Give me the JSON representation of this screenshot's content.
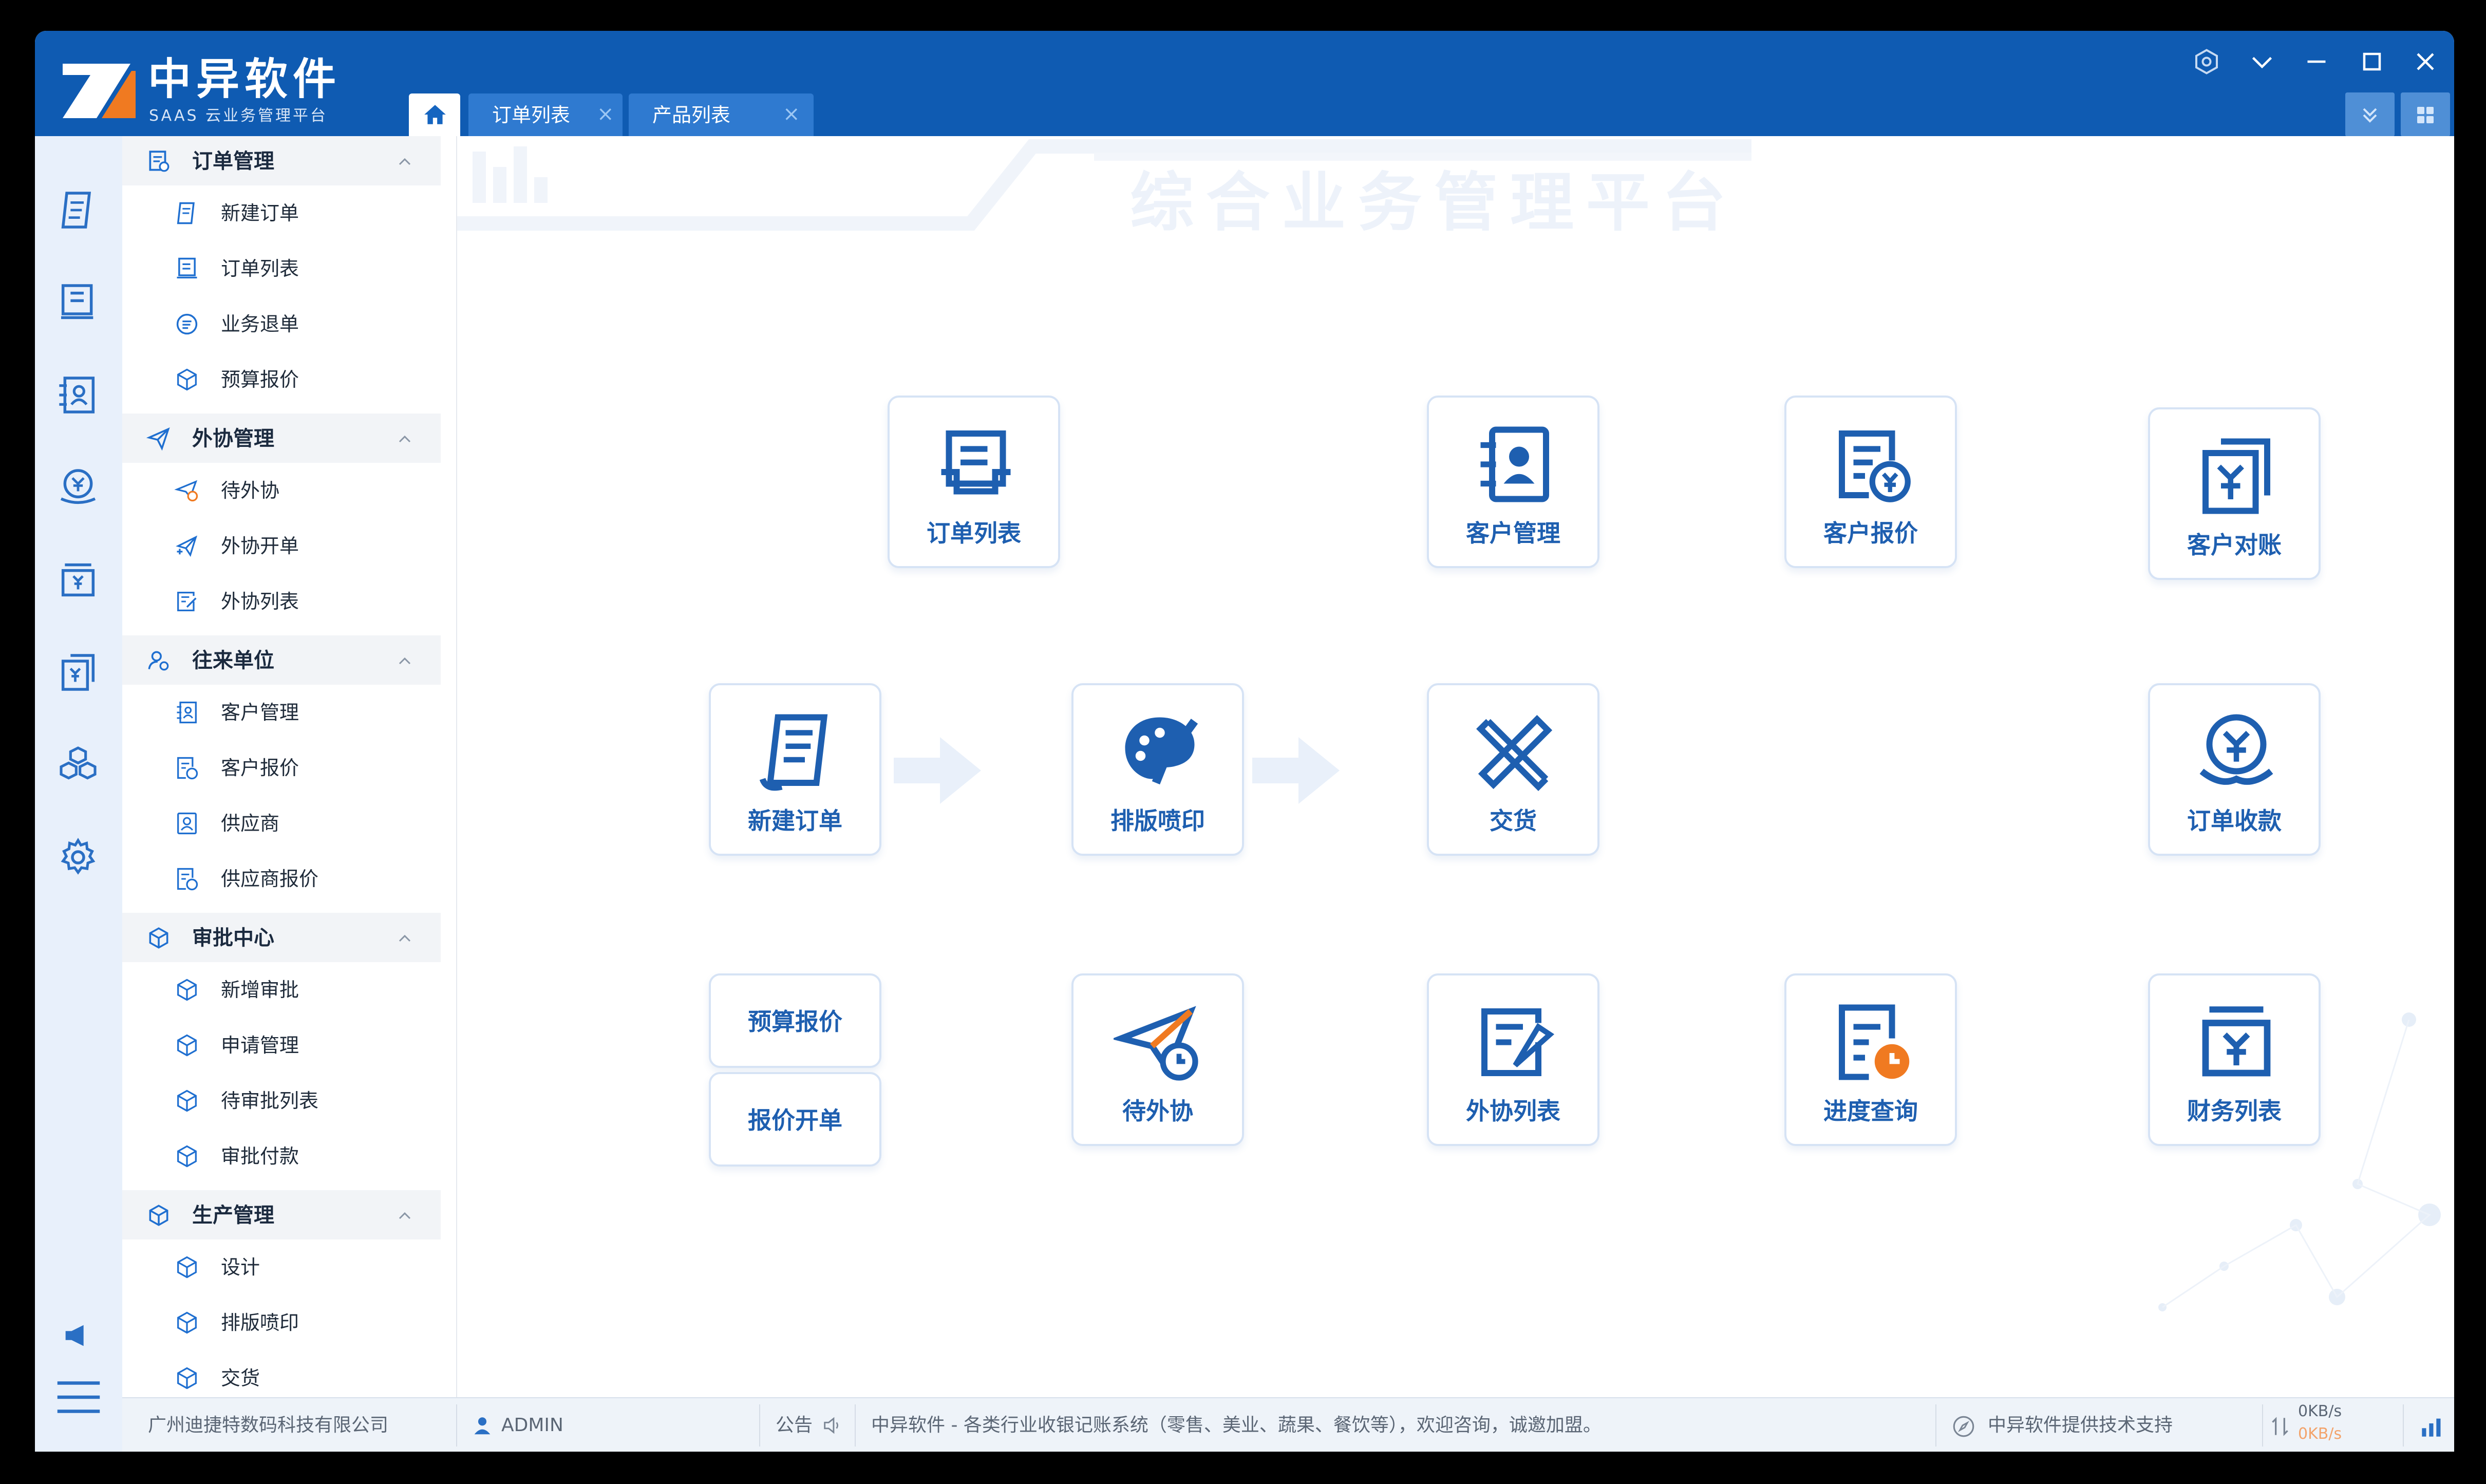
{
  "brand": {
    "name": "中异软件",
    "subtitle": "SAAS 云业务管理平台"
  },
  "tabs": [
    {
      "label": "订单列表",
      "closable": true
    },
    {
      "label": "产品列表",
      "closable": true
    }
  ],
  "watermark": "综合业务管理平台",
  "sidebar": {
    "groups": [
      {
        "label": "订单管理",
        "icon": "order-icon",
        "items": [
          {
            "label": "新建订单",
            "icon": "new-order-icon"
          },
          {
            "label": "订单列表",
            "icon": "order-list-icon"
          },
          {
            "label": "业务退单",
            "icon": "refund-icon"
          },
          {
            "label": "预算报价",
            "icon": "box-icon"
          }
        ]
      },
      {
        "label": "外协管理",
        "icon": "paper-plane-icon",
        "items": [
          {
            "label": "待外协",
            "icon": "paper-plane-clock-icon"
          },
          {
            "label": "外协开单",
            "icon": "paper-plane-plus-icon"
          },
          {
            "label": "外协列表",
            "icon": "list-edit-icon"
          }
        ]
      },
      {
        "label": "往来单位",
        "icon": "user-gear-icon",
        "items": [
          {
            "label": "客户管理",
            "icon": "contact-card-icon"
          },
          {
            "label": "客户报价",
            "icon": "quote-icon"
          },
          {
            "label": "供应商",
            "icon": "supplier-icon"
          },
          {
            "label": "供应商报价",
            "icon": "quote-icon"
          }
        ]
      },
      {
        "label": "审批中心",
        "icon": "box-icon",
        "items": [
          {
            "label": "新增审批",
            "icon": "box-icon"
          },
          {
            "label": "申请管理",
            "icon": "box-icon"
          },
          {
            "label": "待审批列表",
            "icon": "box-icon"
          },
          {
            "label": "审批付款",
            "icon": "box-icon"
          }
        ]
      },
      {
        "label": "生产管理",
        "icon": "box-icon",
        "items": [
          {
            "label": "设计",
            "icon": "box-icon"
          },
          {
            "label": "排版喷印",
            "icon": "box-icon"
          },
          {
            "label": "交货",
            "icon": "box-icon"
          }
        ]
      }
    ]
  },
  "cards": {
    "order_list": "订单列表",
    "customer_mgmt": "客户管理",
    "customer_quote": "客户报价",
    "customer_reconcile": "客户对账",
    "new_order": "新建订单",
    "layout_print": "排版喷印",
    "delivery": "交货",
    "order_collect": "订单收款",
    "budget_quote": "预算报价",
    "quote_order": "报价开单",
    "pending_outsource": "待外协",
    "outsource_list": "外协列表",
    "progress_query": "进度查询",
    "finance_list": "财务列表"
  },
  "status": {
    "company": "广州迪捷特数码科技有限公司",
    "user": "ADMIN",
    "notice_label": "公告",
    "notice_text": "中异软件 - 各类行业收银记账系统（零售、美业、蔬果、餐饮等），欢迎咨询，诚邀加盟。",
    "support": "中异软件提供技术支持",
    "upload": "0KB/s",
    "download": "0KB/s"
  },
  "colors": {
    "titlebar": "#0f5bb2",
    "accent": "#1e5fb0",
    "orange": "#f07a21",
    "tab": "#2f7ad0"
  }
}
